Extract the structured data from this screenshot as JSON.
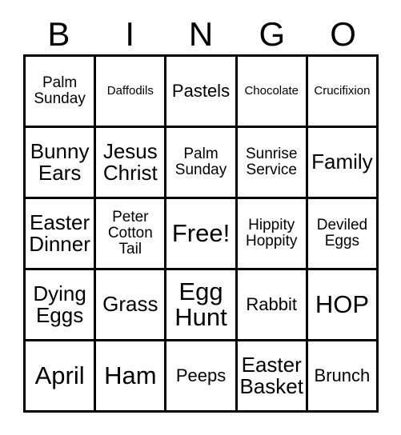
{
  "card": {
    "type": "bingo-card",
    "theme": "Easter",
    "header_letters": [
      "B",
      "I",
      "N",
      "G",
      "O"
    ],
    "grid_size": "5x5",
    "colors": {
      "background": "#ffffff",
      "border": "#000000",
      "text": "#000000"
    },
    "rows": [
      [
        {
          "text": "Palm\nSunday",
          "size": "sz-s"
        },
        {
          "text": "Daffodils",
          "size": "sz-xs"
        },
        {
          "text": "Pastels",
          "size": "sz-m"
        },
        {
          "text": "Chocolate",
          "size": "sz-xs"
        },
        {
          "text": "Crucifixion",
          "size": "sz-xs"
        }
      ],
      [
        {
          "text": "Bunny\nEars",
          "size": "sz-l"
        },
        {
          "text": "Jesus\nChrist",
          "size": "sz-l"
        },
        {
          "text": "Palm\nSunday",
          "size": "sz-s"
        },
        {
          "text": "Sunrise\nService",
          "size": "sz-s"
        },
        {
          "text": "Family",
          "size": "sz-l"
        }
      ],
      [
        {
          "text": "Easter\nDinner",
          "size": "sz-l"
        },
        {
          "text": "Peter\nCotton\nTail",
          "size": "sz-s"
        },
        {
          "text": "Free!",
          "size": "sz-xl"
        },
        {
          "text": "Hippity\nHoppity",
          "size": "sz-s"
        },
        {
          "text": "Deviled\nEggs",
          "size": "sz-s"
        }
      ],
      [
        {
          "text": "Dying\nEggs",
          "size": "sz-l"
        },
        {
          "text": "Grass",
          "size": "sz-l"
        },
        {
          "text": "Egg\nHunt",
          "size": "sz-xl"
        },
        {
          "text": "Rabbit",
          "size": "sz-m"
        },
        {
          "text": "HOP",
          "size": "sz-xl"
        }
      ],
      [
        {
          "text": "April",
          "size": "sz-xl"
        },
        {
          "text": "Ham",
          "size": "sz-xl"
        },
        {
          "text": "Peeps",
          "size": "sz-m"
        },
        {
          "text": "Easter\nBasket",
          "size": "sz-l"
        },
        {
          "text": "Brunch",
          "size": "sz-m"
        }
      ]
    ]
  }
}
